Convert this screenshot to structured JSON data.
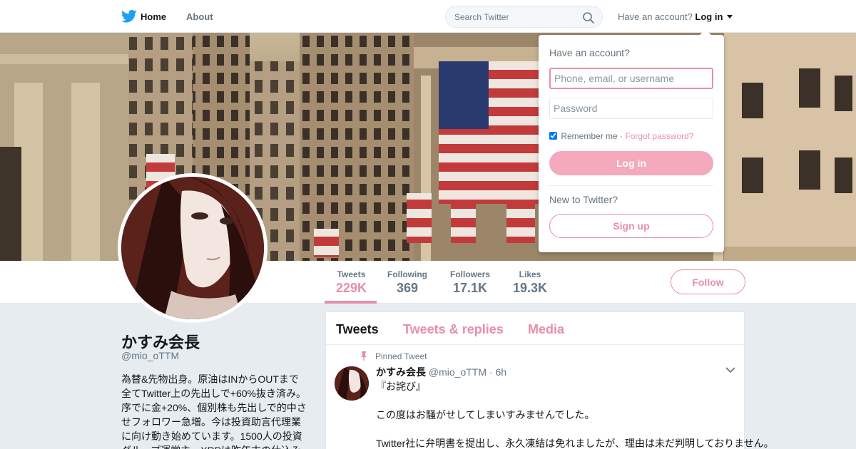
{
  "nav": {
    "home_label": "Home",
    "about_label": "About",
    "search_placeholder": "Search Twitter",
    "have_account": "Have an account?",
    "login_label": "Log in"
  },
  "profile": {
    "name": "かすみ会長",
    "handle": "@mio_oTTM",
    "bio": "為替&先物出身。原油はINからOUTまで全てTwitter上の先出しで+60%抜き済み。序でに金+20%、個別株も先出しで的中させフォロワー急増。今は投資助言代理業に向け動き始めています。1500人の投資グループ運営主。XRPは昨年末の仕込み"
  },
  "stats": [
    {
      "label": "Tweets",
      "value": "229K"
    },
    {
      "label": "Following",
      "value": "369"
    },
    {
      "label": "Followers",
      "value": "17.1K"
    },
    {
      "label": "Likes",
      "value": "19.3K"
    }
  ],
  "follow_label": "Follow",
  "timeline": {
    "tabs": [
      "Tweets",
      "Tweets & replies",
      "Media"
    ],
    "pinned_label": "Pinned Tweet",
    "tweet": {
      "name": "かすみ会長",
      "handle": "@mio_oTTM",
      "time": "· 6h",
      "line1": "『お詫び』",
      "line2": "この度はお騒がせしてしまいすみませんでした。",
      "line3": "Twitter社に弁明書を提出し、永久凍結は免れましたが、理由は未だ判明しておりません。"
    }
  },
  "login_dropdown": {
    "title": "Have an account?",
    "username_placeholder": "Phone, email, or username",
    "password_placeholder": "Password",
    "remember_label": "Remember me",
    "separator": "·",
    "forgot_label": "Forgot password?",
    "login_button": "Log in",
    "new_label": "New to Twitter?",
    "signup_button": "Sign up"
  },
  "colors": {
    "accent": "#e88fa8",
    "twitter_blue": "#1da1f2",
    "login_button_bg": "#f4a9bd"
  }
}
